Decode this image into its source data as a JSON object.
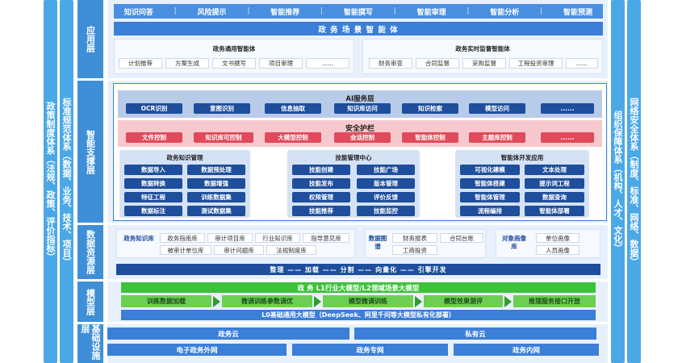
{
  "left_columns": [
    {
      "text": "政策制度体系（法规、政策、评价指标）"
    },
    {
      "text": "标准规范体系（数据、业务、技术、项目）"
    }
  ],
  "right_columns": [
    {
      "text": "组织保障体系（机构、人才、文化）"
    },
    {
      "text": "网络安全体系（制度、标准、网络、数据）"
    }
  ],
  "layers": {
    "application": "应用层",
    "support": "智能支撑层",
    "data": "数据资源层",
    "model": "模型层",
    "infra": "基础设施层"
  },
  "application": {
    "top_items": [
      "知识问答",
      "风险提示",
      "智能推荐",
      "智能撰写",
      "智能审理",
      "智能分析",
      "智能预测"
    ],
    "banner": "政 务 场 景 智 能 体",
    "left_group": {
      "title": "政务通用智能体",
      "items": [
        "计划推荐",
        "方案生成",
        "文书撰写",
        "项目审理",
        "......"
      ]
    },
    "right_group": {
      "title": "政务实时监督智能体",
      "items": [
        "财务审查",
        "合同监督",
        "采购监督",
        "工程投资审理",
        "......"
      ]
    }
  },
  "support": {
    "ai_title": "AI服务层",
    "ai_items": [
      "OCR识别",
      "意图识别",
      "信息抽取",
      "知识库访问",
      "知识检索",
      "模型访问",
      "......"
    ],
    "guard_title": "安全护栏",
    "guard_items": [
      "文件控制",
      "知识库可控制",
      "大模型控制",
      "会话控制",
      "智能体控制",
      "主题库控制",
      "......"
    ],
    "groups": [
      {
        "title": "政务知识管理",
        "items": [
          "数据导入",
          "数据预处理",
          "数据转换",
          "数据增强",
          "特征工程",
          "训练数据集",
          "数据标注",
          "测试数据集"
        ]
      },
      {
        "title": "技能管理中心",
        "items": [
          "技能创建",
          "技能广场",
          "技能发布",
          "版本管理",
          "权限管理",
          "评价反馈",
          "技能推荐",
          "技能监控"
        ]
      },
      {
        "title": "智能体开发应用",
        "items": [
          "可视化建模",
          "文本处理",
          "智能体搭建",
          "提示词工程",
          "智能体管理",
          "数据查询",
          "流程编排",
          "智能体部署"
        ]
      }
    ]
  },
  "data": {
    "group1_label": "政务知识库",
    "group1_items": [
      "政务指南库",
      "审计项目库",
      "行业知识库",
      "指导意见库",
      "被审计单位库",
      "审计问题库",
      "法规制度库"
    ],
    "group2_label": "数据图谱",
    "group2_items": [
      "财务报表",
      "合同台账",
      "工商投资"
    ],
    "group3_label": "对象画像库",
    "group3_items": [
      "单位画像",
      "人员画像"
    ],
    "flow": "整理 —— 加载 —— 分割 —— 向量化 —— 引擎开发"
  },
  "model": {
    "top_bar": "政 务 L1行业大模型/L2领域场景大模型",
    "steps": [
      "训练数据加载",
      "微调训练参数调优",
      "模型微调训练",
      "模型效果测评",
      "推理服务接口开放"
    ],
    "base_bar": "L0基础通用大模型（DeepSeek、阿里千问等大模型私有化部署）"
  },
  "infra": {
    "clouds": [
      "政务云",
      "私有云"
    ],
    "networks": [
      "电子政务外网",
      "政务专网",
      "政务内网"
    ]
  },
  "colors": {
    "navy": "#1e4e9c",
    "blue": "#3f8fd6",
    "light": "#e8f1fb",
    "red": "#e04a5a",
    "green": "#3ec13a"
  }
}
